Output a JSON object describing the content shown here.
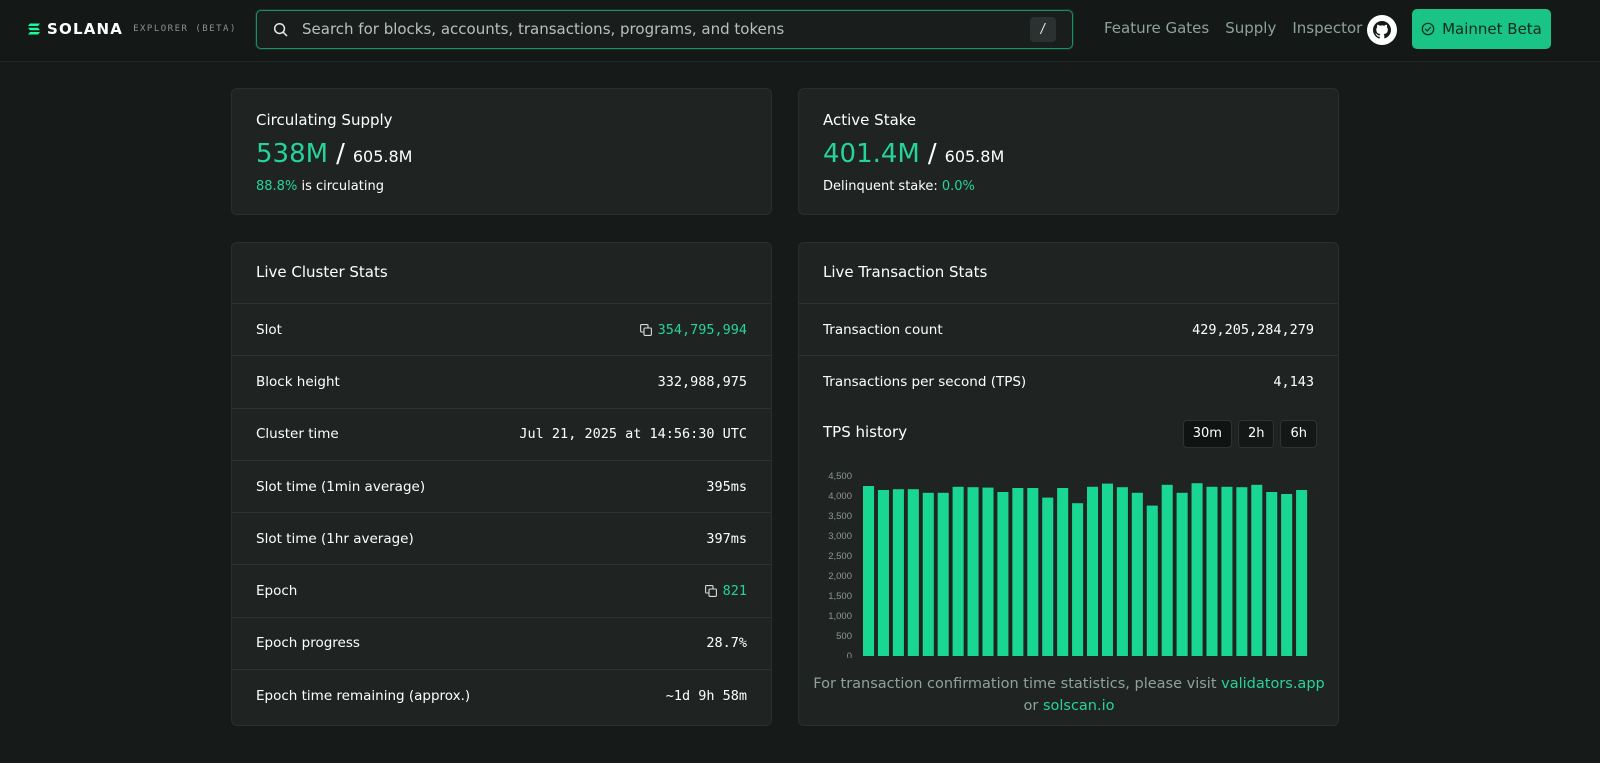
{
  "header": {
    "logo_text": "SOLANA",
    "logo_sub": "EXPLORER (BETA)",
    "search_placeholder": "Search for blocks, accounts, transactions, programs, and tokens",
    "search_shortcut": "/",
    "nav": [
      {
        "label": "Feature Gates"
      },
      {
        "label": "Supply"
      },
      {
        "label": "Inspector"
      }
    ],
    "github_icon": "github-icon",
    "network_button": "Mainnet Beta"
  },
  "supply": {
    "title": "Circulating Supply",
    "value": "538M",
    "separator": "/",
    "total": "605.8M",
    "percent": "88.8%",
    "percent_suffix": "is circulating"
  },
  "stake": {
    "title": "Active Stake",
    "value": "401.4M",
    "separator": "/",
    "total": "605.8M",
    "delinquent_label": "Delinquent stake:",
    "delinquent_value": "0.0%"
  },
  "cluster": {
    "title": "Live Cluster Stats",
    "rows": [
      {
        "label": "Slot",
        "value": "354,795,994"
      },
      {
        "label": "Block height",
        "value": "332,988,975"
      },
      {
        "label": "Cluster time",
        "value": "Jul 21, 2025 at 14:56:30 UTC"
      },
      {
        "label": "Slot time (1min average)",
        "value": "395ms"
      },
      {
        "label": "Slot time (1hr average)",
        "value": "397ms"
      },
      {
        "label": "Epoch",
        "value": "821"
      },
      {
        "label": "Epoch progress",
        "value": "28.7%"
      },
      {
        "label": "Epoch time remaining (approx.)",
        "value": "~1d 9h 58m"
      }
    ]
  },
  "transactions": {
    "title": "Live Transaction Stats",
    "rows": [
      {
        "label": "Transaction count",
        "value": "429,205,284,279"
      },
      {
        "label": "Transactions per second (TPS)",
        "value": "4,143"
      }
    ],
    "history_title": "TPS history",
    "ranges": [
      "30m",
      "2h",
      "6h"
    ],
    "footnote_prefix": "For transaction confirmation time statistics, please visit",
    "link1": "validators.app",
    "footnote_mid": "or",
    "link2": "solscan.io"
  },
  "colors": {
    "accent": "#26d39a",
    "bar": "#19d692",
    "background": "#161a19",
    "card": "#1f2423"
  },
  "chart_data": {
    "type": "bar",
    "title": "TPS history",
    "ylim": [
      0,
      4500
    ],
    "yticks": [
      "0",
      "500",
      "1,000",
      "1,500",
      "2,000",
      "2,500",
      "3,000",
      "3,500",
      "4,000",
      "4,500"
    ],
    "values": [
      4250,
      4150,
      4170,
      4170,
      4080,
      4080,
      4230,
      4220,
      4210,
      4100,
      4200,
      4200,
      3960,
      4200,
      3820,
      4230,
      4310,
      4220,
      4080,
      3760,
      4280,
      4080,
      4320,
      4230,
      4230,
      4220,
      4280,
      4100,
      4050,
      4150
    ]
  }
}
